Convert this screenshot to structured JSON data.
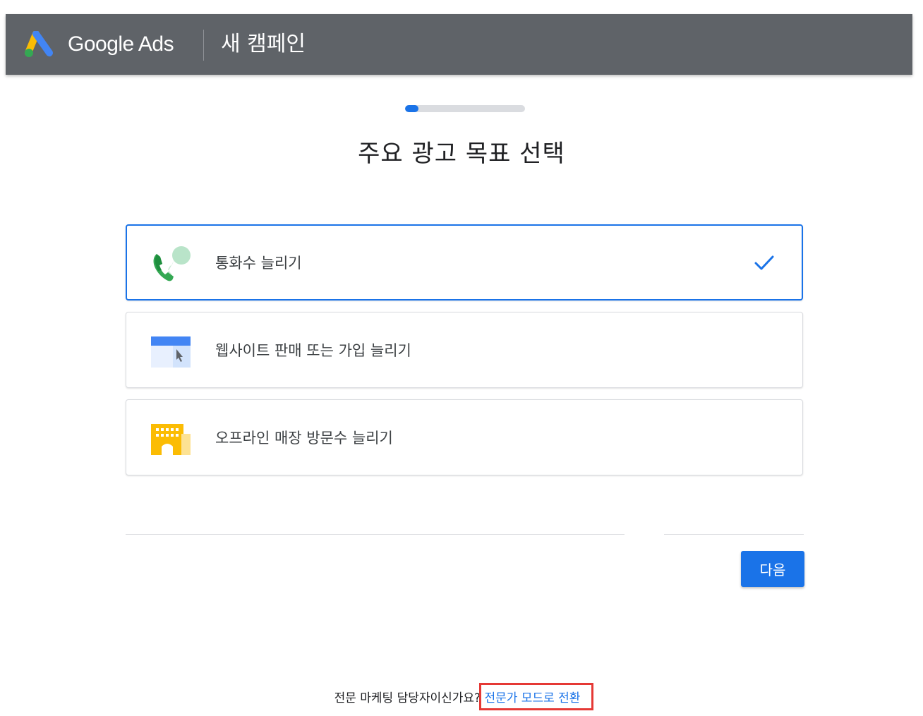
{
  "header": {
    "brand": "Google Ads",
    "campaign_title": "새 캠페인"
  },
  "progress": {
    "value_percent": 11
  },
  "page_title": "주요 광고 목표 선택",
  "options": [
    {
      "label": "통화수 늘리기",
      "icon": "phone-call-icon",
      "selected": true
    },
    {
      "label": "웹사이트 판매 또는 가입 늘리기",
      "icon": "website-cursor-icon",
      "selected": false
    },
    {
      "label": "오프라인 매장 방문수 늘리기",
      "icon": "store-building-icon",
      "selected": false
    }
  ],
  "next_button": "다음",
  "footer": {
    "question": "전문 마케팅 담당자이신가요?",
    "link": "전문가 모드로 전환"
  },
  "colors": {
    "header_bg": "#5f6368",
    "accent": "#1a73e8",
    "highlight_box": "#e53935"
  }
}
